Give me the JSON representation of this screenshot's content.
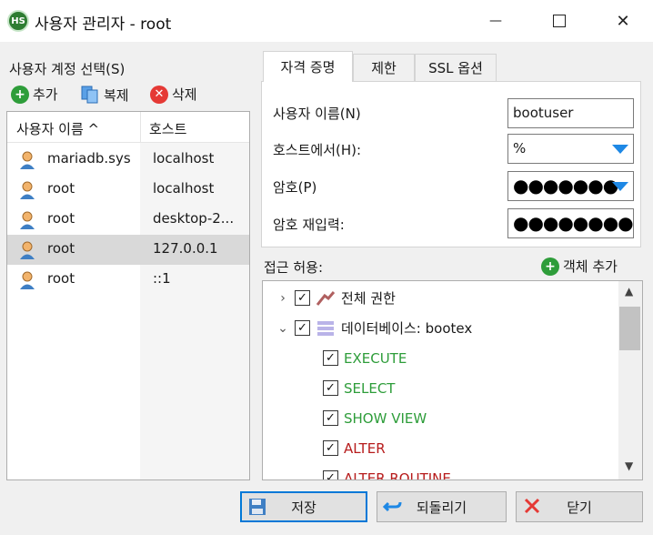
{
  "window": {
    "app_icon_text": "HS",
    "title": "사용자 관리자 - root",
    "minimize_glyph": "—",
    "maximize_glyph": "☐",
    "close_glyph": "✕"
  },
  "left": {
    "select_label": "사용자 계정 선택(S)",
    "toolbar": {
      "add_label": "추가",
      "clone_label": "복제",
      "delete_label": "삭제"
    },
    "columns": {
      "user": "사용자 이름 ^",
      "host": "호스트"
    },
    "users": [
      {
        "name": "mariadb.sys",
        "host": "localhost",
        "selected": false
      },
      {
        "name": "root",
        "host": "localhost",
        "selected": false
      },
      {
        "name": "root",
        "host": "desktop-2...",
        "selected": false
      },
      {
        "name": "root",
        "host": "127.0.0.1",
        "selected": true
      },
      {
        "name": "root",
        "host": "::1",
        "selected": false
      }
    ]
  },
  "tabs": [
    {
      "label": "자격 증명",
      "active": true
    },
    {
      "label": "제한",
      "active": false
    },
    {
      "label": "SSL 옵션",
      "active": false
    }
  ],
  "credentials": {
    "username_label": "사용자 이름(N)",
    "username_value": "bootuser",
    "host_label": "호스트에서(H):",
    "host_value": "%",
    "password_label": "암호(P)",
    "password_value": "●●●●●●●",
    "repeat_label": "암호 재입력:",
    "repeat_value": "●●●●●●●●●"
  },
  "access": {
    "label": "접근 허용:",
    "add_object_label": "객체 추가",
    "tree": {
      "global_label": "전체 권한",
      "database_label": "데이터베이스: bootex",
      "privileges": [
        {
          "label": "EXECUTE",
          "checked": true,
          "color": "#2e9d3a"
        },
        {
          "label": "SELECT",
          "checked": true,
          "color": "#2e9d3a"
        },
        {
          "label": "SHOW VIEW",
          "checked": true,
          "color": "#2e9d3a"
        },
        {
          "label": "ALTER",
          "checked": true,
          "color": "#b71c1c"
        },
        {
          "label": "ALTER ROUTINE",
          "checked": true,
          "color": "#b71c1c"
        }
      ]
    }
  },
  "buttons": {
    "save_label": "저장",
    "revert_label": "되돌리기",
    "close_label": "닫기"
  }
}
